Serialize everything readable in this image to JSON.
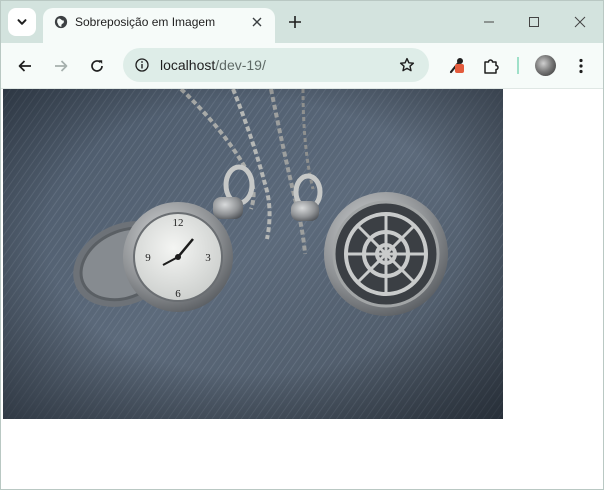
{
  "browser": {
    "tab": {
      "title": "Sobreposição em Imagem"
    },
    "address": {
      "host": "localhost",
      "path": "/dev-19/"
    }
  },
  "page": {
    "image": {
      "subject": "two antique silver pocket watches on chains lying on denim fabric"
    }
  },
  "icons": {
    "tab_search": "chevron-down-icon",
    "favicon": "globe-icon",
    "tab_close": "close-icon",
    "new_tab": "plus-icon",
    "back": "arrow-left-icon",
    "forward": "arrow-right-icon",
    "reload": "reload-icon",
    "site_info": "info-icon",
    "bookmark": "star-icon",
    "extension": "extension-icon",
    "puzzle": "puzzle-icon",
    "profile": "avatar",
    "menu": "kebab-menu-icon"
  },
  "colors": {
    "tab_strip": "#d3e3de",
    "toolbar": "#f6fbf9",
    "omnibox": "#deede8",
    "extension_badge": "#e35b3c",
    "divider": "#9fe0c9"
  }
}
